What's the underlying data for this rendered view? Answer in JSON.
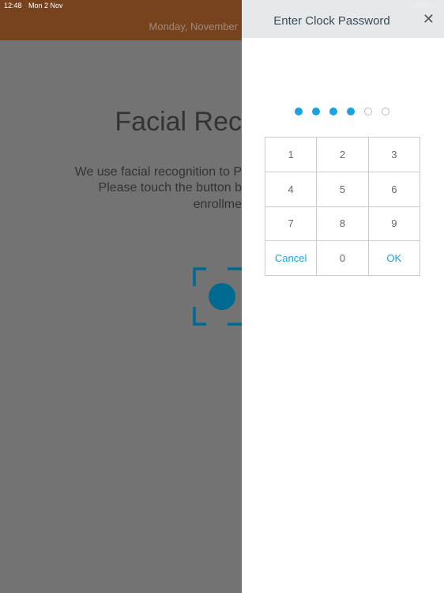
{
  "status_bar": {
    "time": "12:48",
    "date": "Mon 2 Nov",
    "battery": "35%"
  },
  "header": {
    "date": "Monday, November"
  },
  "background": {
    "title": "Facial Rec",
    "lines": [
      "We use facial recognition to P",
      "Please touch the button b",
      "enrollme"
    ]
  },
  "colors": {
    "header_brown": "#77431f",
    "accent": "#1aa3e0",
    "face_icon": "#00698f"
  },
  "dialog": {
    "title": "Enter Clock Password",
    "close_icon": "close-icon",
    "pin_length": 6,
    "pin_entered": 4,
    "keys": [
      "1",
      "2",
      "3",
      "4",
      "5",
      "6",
      "7",
      "8",
      "9",
      "Cancel",
      "0",
      "OK"
    ]
  }
}
